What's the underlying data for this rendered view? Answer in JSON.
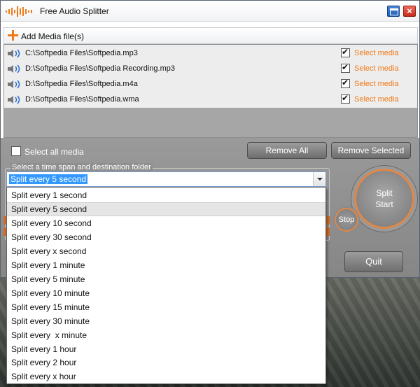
{
  "window": {
    "title": "Free Audio Splitter"
  },
  "toolbar": {
    "add_media_label": "Add Media file(s)"
  },
  "media_files": [
    {
      "path": "C:\\Softpedia Files\\Softpedia.mp3",
      "checked": true,
      "action": "Select media"
    },
    {
      "path": "D:\\Softpedia Files\\Softpedia Recording.mp3",
      "checked": true,
      "action": "Select media"
    },
    {
      "path": "D:\\Softpedia Files\\Softpedia.m4a",
      "checked": true,
      "action": "Select media"
    },
    {
      "path": "D:\\Softpedia Files\\Softpedia.wma",
      "checked": true,
      "action": "Select media"
    }
  ],
  "controls": {
    "select_all_label": "Select all media",
    "remove_all": "Remove All",
    "remove_selected": "Remove Selected",
    "group_label": "Select a time span and destination folder",
    "split_start": "Split\nStart",
    "stop": "Stop",
    "quit": "Quit"
  },
  "split_combo": {
    "selected": "Split every 5 second",
    "options": [
      "Split every 1 second",
      "Split every 5 second",
      "Split every 10 second",
      "Split every 30 second",
      "Split every x second",
      "Split every 1 minute",
      "Split every 5 minute",
      "Split every 10 minute",
      "Split every 15 minute",
      "Split every 30 minute",
      "Split every  x minute",
      "Split every 1 hour",
      "Split every 2 hour",
      "Split every x hour"
    ],
    "highlighted_index": 1
  },
  "colors": {
    "accent_orange": "#f07a18",
    "selection_blue": "#3399ff"
  }
}
